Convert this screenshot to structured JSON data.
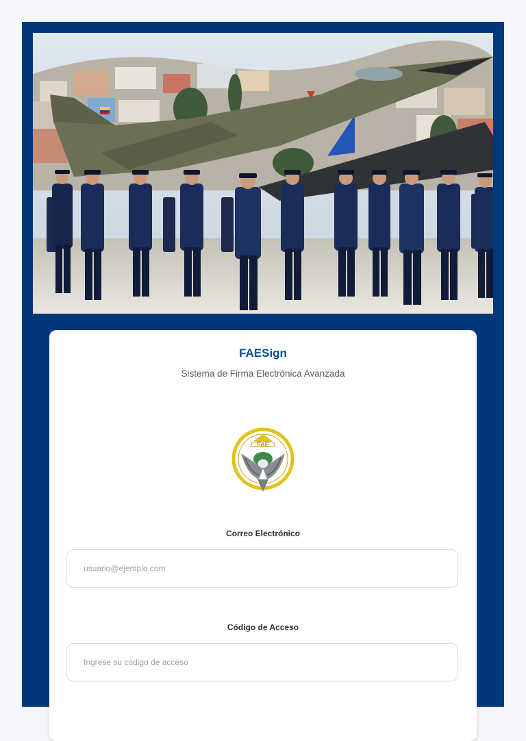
{
  "colors": {
    "frame_background": "#00397a",
    "page_background": "#f4f6f9",
    "title_color": "#0d4f97"
  },
  "hero": {
    "image_description": "Honor guard of air force cadets standing in formation in front of a camouflaged fighter jet with a hillside city in the background",
    "icon": "hero-photo"
  },
  "login": {
    "title": "FAESign",
    "subtitle": "Sistema de Firma Electrónica Avanzada",
    "emblem": {
      "icon": "fae-emblem",
      "text": "FAE"
    },
    "email": {
      "label": "Correo Electrónico",
      "placeholder": "usuario@ejemplo.com",
      "value": ""
    },
    "access_code": {
      "label": "Código de Acceso",
      "placeholder": "Ingrese su código de acceso",
      "value": ""
    }
  }
}
